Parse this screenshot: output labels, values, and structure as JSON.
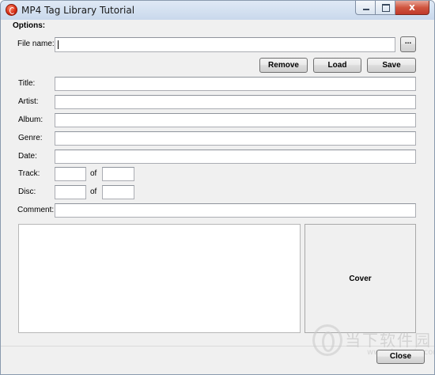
{
  "window": {
    "title": "MP4 Tag Library Tutorial",
    "close_glyph": "x"
  },
  "options": {
    "label": "Options:",
    "file_name_label": "File name:",
    "file_name_value": "",
    "browse_label": "...",
    "remove_label": "Remove",
    "load_label": "Load",
    "save_label": "Save"
  },
  "tags": {
    "title_label": "Title:",
    "title_value": "",
    "artist_label": "Artist:",
    "artist_value": "",
    "album_label": "Album:",
    "album_value": "",
    "genre_label": "Genre:",
    "genre_value": "",
    "date_label": "Date:",
    "date_value": "",
    "track_label": "Track:",
    "track_value": "",
    "track_of_label": "of",
    "track_total_value": "",
    "disc_label": "Disc:",
    "disc_value": "",
    "disc_of_label": "of",
    "disc_total_value": "",
    "comment_label": "Comment:",
    "comment_value": ""
  },
  "cover": {
    "label": "Cover"
  },
  "footer": {
    "close_label": "Close"
  },
  "watermark": {
    "chinese_text": "当下软件园",
    "url": "www.downxia.com"
  },
  "colors": {
    "window_bg": "#f0f0f0",
    "titlebar": "#d3e0f0",
    "close_button": "#c0392b"
  }
}
